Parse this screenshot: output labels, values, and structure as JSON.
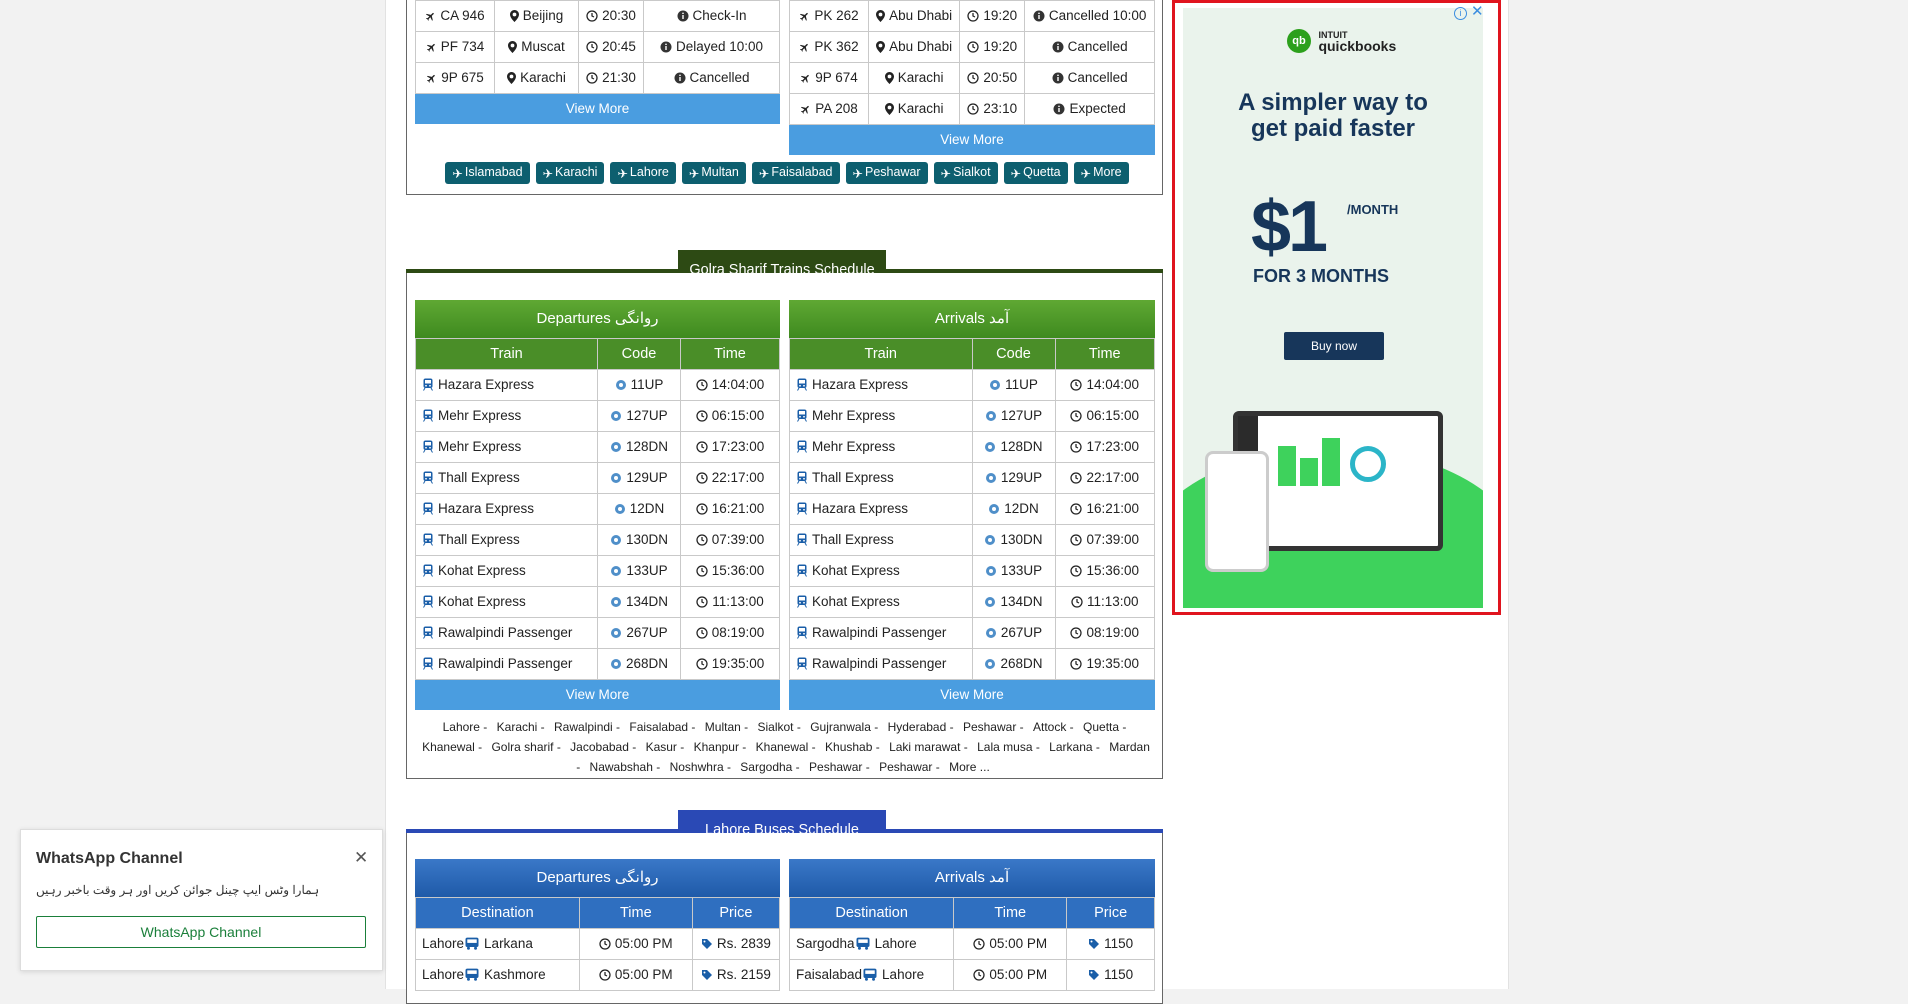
{
  "flights": {
    "left": [
      {
        "flight": "CA 946",
        "city": "Beijing",
        "time": "20:30",
        "status": "Check-In"
      },
      {
        "flight": "PF 734",
        "city": "Muscat",
        "time": "20:45",
        "status": "Delayed 10:00"
      },
      {
        "flight": "9P 675",
        "city": "Karachi",
        "time": "21:30",
        "status": "Cancelled"
      }
    ],
    "right": [
      {
        "flight": "PK 262",
        "city": "Abu Dhabi",
        "time": "19:20",
        "status": "Cancelled 10:00"
      },
      {
        "flight": "PK 362",
        "city": "Abu Dhabi",
        "time": "19:20",
        "status": "Cancelled"
      },
      {
        "flight": "9P 674",
        "city": "Karachi",
        "time": "20:50",
        "status": "Cancelled"
      },
      {
        "flight": "PA 208",
        "city": "Karachi",
        "time": "23:10",
        "status": "Expected"
      }
    ],
    "view_more": "View More",
    "city_tags": [
      "Islamabad",
      "Karachi",
      "Lahore",
      "Multan",
      "Faisalabad",
      "Peshawar",
      "Sialkot",
      "Quetta",
      "More"
    ]
  },
  "trains": {
    "title": "Golra Sharif Trains Schedule",
    "departures_title": "Departures روانگی",
    "arrivals_title": "Arrivals آمد",
    "headers": [
      "Train",
      "Code",
      "Time"
    ],
    "departures": [
      {
        "train": "Hazara Express",
        "code": "11UP",
        "time": "14:04:00"
      },
      {
        "train": "Mehr Express",
        "code": "127UP",
        "time": "06:15:00"
      },
      {
        "train": "Mehr Express",
        "code": "128DN",
        "time": "17:23:00"
      },
      {
        "train": "Thall Express",
        "code": "129UP",
        "time": "22:17:00"
      },
      {
        "train": "Hazara Express",
        "code": "12DN",
        "time": "16:21:00"
      },
      {
        "train": "Thall Express",
        "code": "130DN",
        "time": "07:39:00"
      },
      {
        "train": "Kohat Express",
        "code": "133UP",
        "time": "15:36:00"
      },
      {
        "train": "Kohat Express",
        "code": "134DN",
        "time": "11:13:00"
      },
      {
        "train": "Rawalpindi Passenger",
        "code": "267UP",
        "time": "08:19:00"
      },
      {
        "train": "Rawalpindi Passenger",
        "code": "268DN",
        "time": "19:35:00"
      }
    ],
    "arrivals": [
      {
        "train": "Hazara Express",
        "code": "11UP",
        "time": "14:04:00"
      },
      {
        "train": "Mehr Express",
        "code": "127UP",
        "time": "06:15:00"
      },
      {
        "train": "Mehr Express",
        "code": "128DN",
        "time": "17:23:00"
      },
      {
        "train": "Thall Express",
        "code": "129UP",
        "time": "22:17:00"
      },
      {
        "train": "Hazara Express",
        "code": "12DN",
        "time": "16:21:00"
      },
      {
        "train": "Thall Express",
        "code": "130DN",
        "time": "07:39:00"
      },
      {
        "train": "Kohat Express",
        "code": "133UP",
        "time": "15:36:00"
      },
      {
        "train": "Kohat Express",
        "code": "134DN",
        "time": "11:13:00"
      },
      {
        "train": "Rawalpindi Passenger",
        "code": "267UP",
        "time": "08:19:00"
      },
      {
        "train": "Rawalpindi Passenger",
        "code": "268DN",
        "time": "19:35:00"
      }
    ],
    "view_more": "View More",
    "city_links": [
      "Lahore -",
      "Karachi -",
      "Rawalpindi -",
      "Faisalabad -",
      "Multan -",
      "Sialkot -",
      "Gujranwala -",
      "Hyderabad -",
      "Peshawar -",
      "Attock -",
      "Quetta -",
      "Khanewal -",
      "Golra sharif -",
      "Jacobabad -",
      "Kasur -",
      "Khanpur -",
      "Khanewal -",
      "Khushab -",
      "Laki marawat -",
      "Lala musa -",
      "Larkana -",
      "Mardan -",
      "Nawabshah -",
      "Noshwhra -",
      "Sargodha -",
      "Peshawar -",
      "Peshawar -",
      "More ..."
    ]
  },
  "buses": {
    "title": "Lahore Buses Schedule",
    "departures_title": "Departures روانگی",
    "arrivals_title": "Arrivals آمد",
    "headers": [
      "Destination",
      "Time",
      "Price"
    ],
    "departures": [
      {
        "from": "Lahore",
        "to": "Larkana",
        "time": "05:00 PM",
        "price": "Rs. 2839"
      },
      {
        "from": "Lahore",
        "to": "Kashmore",
        "time": "05:00 PM",
        "price": "Rs. 2159"
      }
    ],
    "arrivals": [
      {
        "from": "Sargodha",
        "to": "Lahore",
        "time": "05:00 PM",
        "price": "1150"
      },
      {
        "from": "Faisalabad",
        "to": "Lahore",
        "time": "05:00 PM",
        "price": "1150"
      }
    ]
  },
  "ad": {
    "brand_top": "INTUIT",
    "brand": "quickbooks",
    "headline": "A simpler way to get paid faster",
    "price": "$1",
    "per": "/MONTH",
    "duration": "FOR 3 MONTHS",
    "cta": "Buy now"
  },
  "whatsapp": {
    "title": "WhatsApp Channel",
    "urdu_text": "ہمارا وٹس ایپ چینل جوائن کریں اور ہر وقت باخبر رہیں",
    "button": "WhatsApp Channel"
  }
}
